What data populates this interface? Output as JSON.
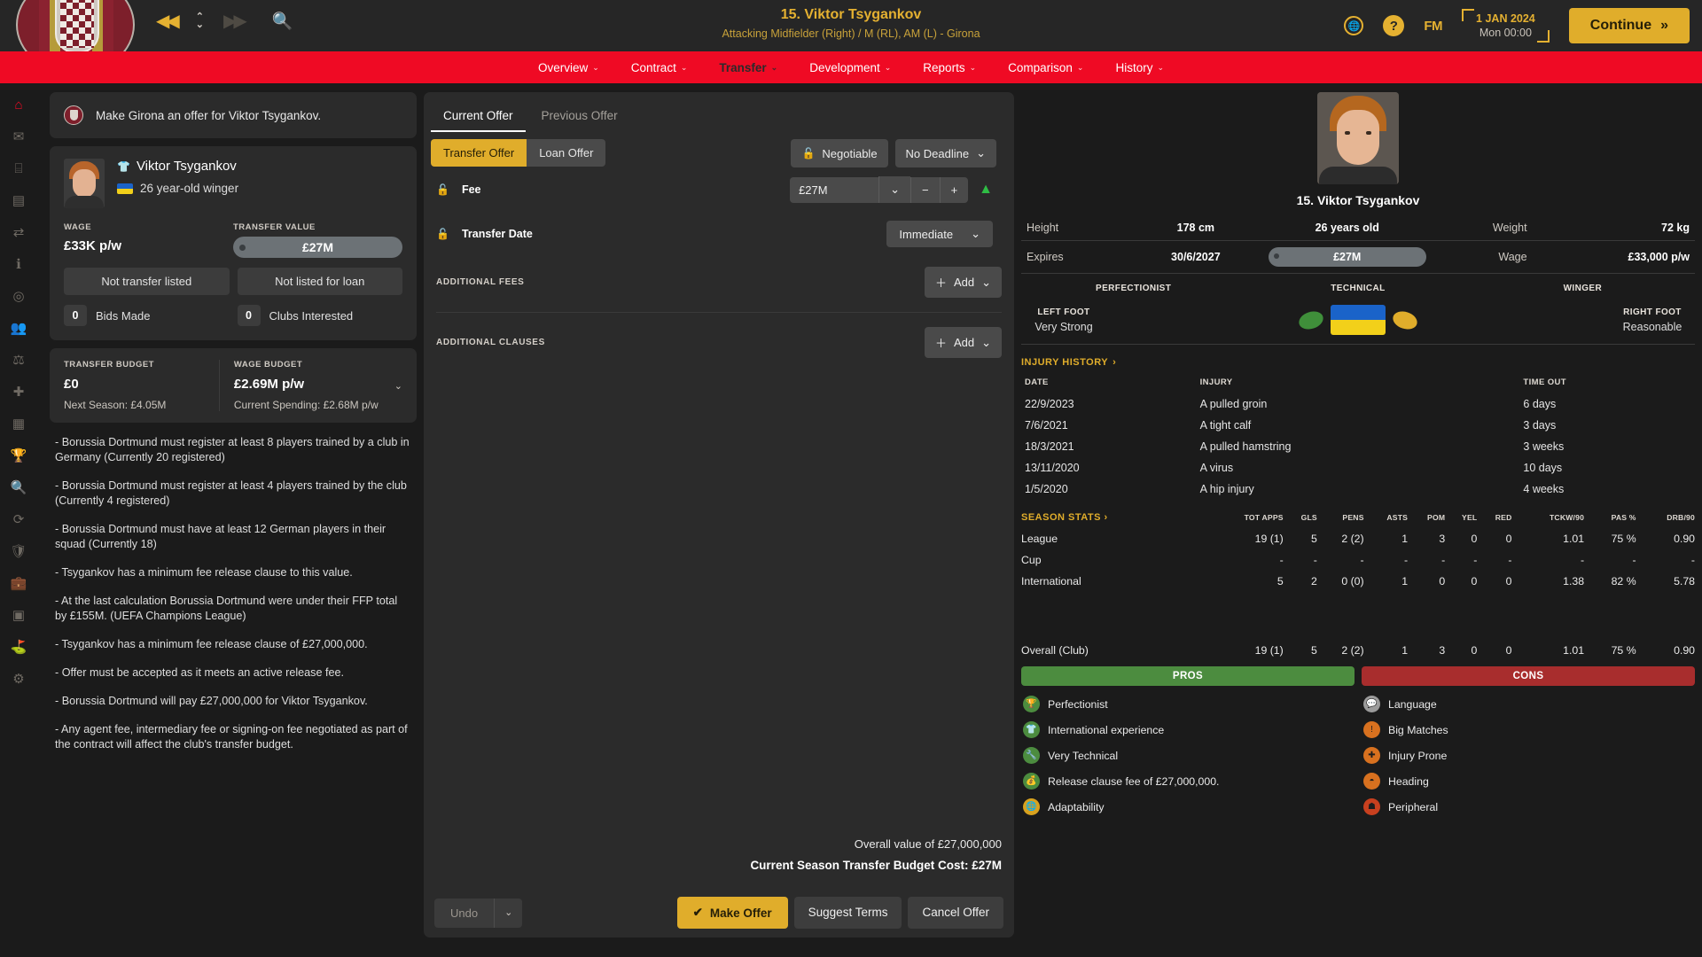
{
  "topbar": {
    "rewind_icon": "rewind-icon",
    "updown_icon": "speed-updown-icon",
    "forward_icon": "fast-forward-icon",
    "search_icon": "search-icon",
    "title": "15. Viktor Tsygankov",
    "subtitle": "Attacking Midfielder (Right) / M (RL), AM (L) - Girona",
    "globe_label": "FM",
    "help_label": "?",
    "fm_label": "FM",
    "date": "1 JAN 2024",
    "time": "Mon 00:00",
    "continue_label": "Continue"
  },
  "menu": [
    {
      "label": "Overview",
      "active": false
    },
    {
      "label": "Contract",
      "active": false
    },
    {
      "label": "Transfer",
      "active": true
    },
    {
      "label": "Development",
      "active": false
    },
    {
      "label": "Reports",
      "active": false
    },
    {
      "label": "Comparison",
      "active": false
    },
    {
      "label": "History",
      "active": false
    }
  ],
  "left": {
    "notice": "Make Girona an offer for Viktor Tsygankov.",
    "player_name": "Viktor Tsygankov",
    "player_desc": "26 year-old winger",
    "wage_label": "WAGE",
    "wage_value": "£33K p/w",
    "transfer_value_label": "TRANSFER VALUE",
    "transfer_value": "£27M",
    "not_transfer_listed": "Not transfer listed",
    "not_listed_loan": "Not listed for loan",
    "bids_made_count": "0",
    "bids_made_label": "Bids Made",
    "clubs_interested_count": "0",
    "clubs_interested_label": "Clubs Interested",
    "transfer_budget_label": "TRANSFER BUDGET",
    "transfer_budget_value": "£0",
    "transfer_budget_note": "Next Season: £4.05M",
    "wage_budget_label": "WAGE BUDGET",
    "wage_budget_value": "£2.69M p/w",
    "wage_budget_note": "Current Spending: £2.68M p/w",
    "clauses": [
      "- Borussia Dortmund must register at least 8 players trained by a club in Germany (Currently 20 registered)",
      "- Borussia Dortmund must register at least 4 players trained by the club (Currently 4 registered)",
      "- Borussia Dortmund must have at least 12 German players in their squad (Currently 18)",
      "- Tsygankov has a minimum fee release clause to this value.",
      "- At the last calculation Borussia Dortmund were under their FFP total by £155M. (UEFA Champions League)",
      "- Tsygankov has a minimum fee release clause of £27,000,000.",
      "- Offer must be accepted as it meets an active release fee.",
      "- Borussia Dortmund will pay £27,000,000 for Viktor Tsygankov.",
      "- Any agent fee, intermediary fee or signing-on fee negotiated as part of the contract will affect the club's transfer budget."
    ]
  },
  "center": {
    "tabs": [
      {
        "label": "Current Offer",
        "active": true
      },
      {
        "label": "Previous Offer",
        "active": false
      }
    ],
    "segments": [
      {
        "label": "Transfer Offer",
        "active": true
      },
      {
        "label": "Loan Offer",
        "active": false
      }
    ],
    "negotiable_label": "Negotiable",
    "deadline_label": "No Deadline",
    "fee_label": "Fee",
    "fee_value": "£27M",
    "minus_label": "−",
    "plus_label": "+",
    "transfer_date_label": "Transfer Date",
    "transfer_date_value": "Immediate",
    "additional_fees_label": "ADDITIONAL FEES",
    "additional_clauses_label": "ADDITIONAL CLAUSES",
    "add_label": "Add",
    "overall_value": "Overall value of £27,000,000",
    "budget_cost": "Current Season Transfer Budget Cost: £27M",
    "undo_label": "Undo",
    "make_offer_label": "Make Offer",
    "suggest_terms_label": "Suggest Terms",
    "cancel_offer_label": "Cancel Offer"
  },
  "right": {
    "name": "15. Viktor Tsygankov",
    "height_label": "Height",
    "height_value": "178 cm",
    "age_value": "26 years old",
    "weight_label": "Weight",
    "weight_value": "72 kg",
    "expires_label": "Expires",
    "expires_value": "30/6/2027",
    "contract_value": "£27M",
    "wage_label": "Wage",
    "wage_value": "£33,000 p/w",
    "trait_left": "PERFECTIONIST",
    "trait_mid": "TECHNICAL",
    "trait_right": "WINGER",
    "left_foot_label": "LEFT FOOT",
    "left_foot_value": "Very Strong",
    "right_foot_label": "RIGHT FOOT",
    "right_foot_value": "Reasonable",
    "injury_history_label": "INJURY HISTORY",
    "injury_headers": [
      "DATE",
      "INJURY",
      "TIME OUT"
    ],
    "injuries": [
      {
        "date": "22/9/2023",
        "injury": "A pulled groin",
        "time": "6 days"
      },
      {
        "date": "7/6/2021",
        "injury": "A tight calf",
        "time": "3 days"
      },
      {
        "date": "18/3/2021",
        "injury": "A pulled hamstring",
        "time": "3 weeks"
      },
      {
        "date": "13/11/2020",
        "injury": "A virus",
        "time": "10 days"
      },
      {
        "date": "1/5/2020",
        "injury": "A hip injury",
        "time": "4 weeks"
      }
    ],
    "season_stats_label": "SEASON STATS",
    "stat_headers": [
      "TOT APPS",
      "GLS",
      "PENS",
      "ASTS",
      "POM",
      "YEL",
      "RED",
      "TCKW/90",
      "PAS %",
      "DRB/90"
    ],
    "stat_rows": [
      {
        "name": "League",
        "values": [
          "19 (1)",
          "5",
          "2 (2)",
          "1",
          "3",
          "0",
          "0",
          "1.01",
          "75 %",
          "0.90"
        ]
      },
      {
        "name": "Cup",
        "values": [
          "-",
          "-",
          "-",
          "-",
          "-",
          "-",
          "-",
          "-",
          "-",
          "-"
        ]
      },
      {
        "name": "International",
        "values": [
          "5",
          "2",
          "0 (0)",
          "1",
          "0",
          "0",
          "0",
          "1.38",
          "82 %",
          "5.78"
        ]
      }
    ],
    "overall_row": {
      "name": "Overall (Club)",
      "values": [
        "19 (1)",
        "5",
        "2 (2)",
        "1",
        "3",
        "0",
        "0",
        "1.01",
        "75 %",
        "0.90"
      ]
    },
    "pros_label": "PROS",
    "cons_label": "CONS",
    "pros": [
      {
        "label": "Perfectionist",
        "icon": "trophy-icon",
        "color": "#4c8c3f"
      },
      {
        "label": "International experience",
        "icon": "shirt-icon",
        "color": "#4c8c3f"
      },
      {
        "label": "Very Technical",
        "icon": "wrench-icon",
        "color": "#4c8c3f"
      },
      {
        "label": "Release clause fee of £27,000,000.",
        "icon": "coins-icon",
        "color": "#4c8c3f"
      },
      {
        "label": "Adaptability",
        "icon": "globe-icon",
        "color": "#d8a21f"
      }
    ],
    "cons": [
      {
        "label": "Language",
        "icon": "speech-icon",
        "color": "#9b9b9b"
      },
      {
        "label": "Big Matches",
        "icon": "alert-icon",
        "color": "#d8711f"
      },
      {
        "label": "Injury Prone",
        "icon": "plus-cross-icon",
        "color": "#d8711f"
      },
      {
        "label": "Heading",
        "icon": "head-icon",
        "color": "#d8711f"
      },
      {
        "label": "Peripheral",
        "icon": "person-icon",
        "color": "#c8401f"
      }
    ]
  },
  "rail_icons": [
    "home-icon",
    "inbox-icon",
    "stadium-icon",
    "clipboard-icon",
    "transfer-icon",
    "info-icon",
    "tactics-icon",
    "squad-icon",
    "training-icon",
    "medical-icon",
    "schedule-icon",
    "trophy-icon",
    "search-icon",
    "refresh-icon",
    "shield-icon",
    "briefcase-icon",
    "finances-icon",
    "pitch-icon",
    "settings-icon"
  ],
  "colors": {
    "accent": "#e0ad2b",
    "menu_bar": "#ef0a24",
    "panel": "#2b2b2b",
    "pros": "#4c8c3f",
    "cons": "#a82d2d"
  }
}
